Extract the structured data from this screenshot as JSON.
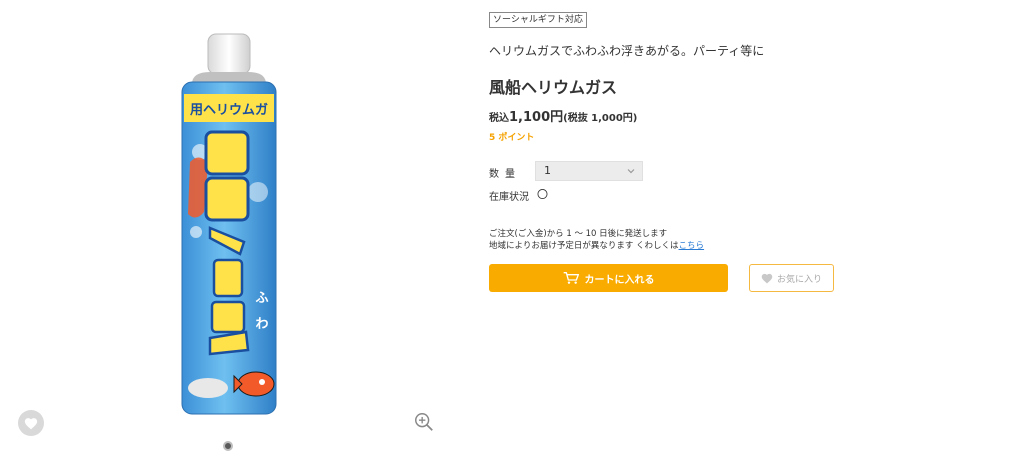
{
  "product": {
    "badge": "ソーシャルギフト対応",
    "catch_copy": "ヘリウムガスでふわふわ浮きあがる。パーティ等に",
    "title": "風船ヘリウムガス",
    "price_prefix": "税込",
    "price_main": "1,100円",
    "price_sub": "(税抜 1,000円)",
    "points": "5 ポイント",
    "image_alt": "風船ヘリウム"
  },
  "purchase": {
    "quantity_label": "数量",
    "quantity_value": "1",
    "stock_label": "在庫状況",
    "stock_mark": "〇",
    "shipping_line1": "ご注文(ご入金)から 1 〜 10 日後に発送します",
    "shipping_line2": "地域によりお届け予定日が異なります くわしくは",
    "shipping_link": "こちら",
    "cart_button": "カートに入れる",
    "favorite_button": "お気に入り"
  },
  "gallery": {
    "slide_count": 1,
    "active_slide": 1
  },
  "colors": {
    "accent": "#f9ab00",
    "points": "#f5a200",
    "link": "#2a7bd4",
    "favorite_border": "#f5b941"
  },
  "icons": {
    "favorite_circle": "heart-icon",
    "zoom": "zoom-in-icon",
    "cart": "cart-icon",
    "favorite": "heart-icon",
    "select": "chevron-down-icon"
  }
}
